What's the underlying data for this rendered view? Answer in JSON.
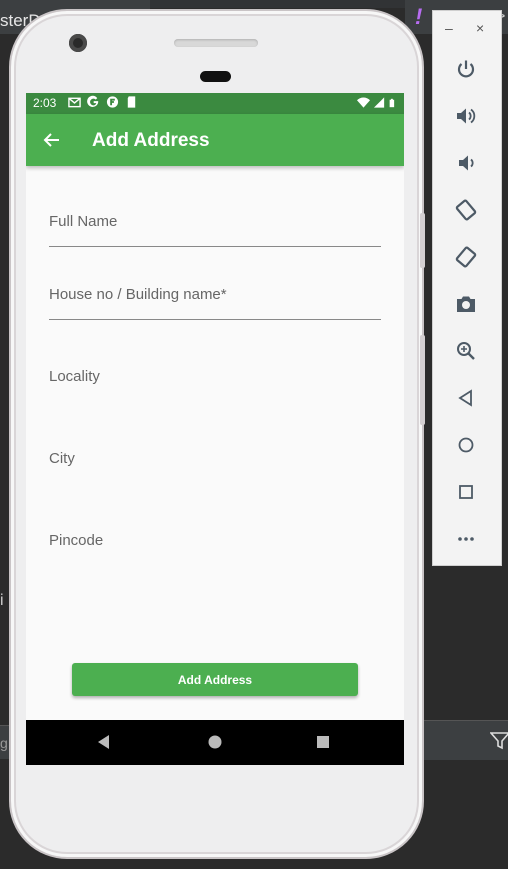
{
  "ide": {
    "tab_text": "sterD",
    "side_text": "i",
    "bottom_text": "g",
    "marker_color": "#b86cf2"
  },
  "status_bar": {
    "time": "2:03",
    "left_icons": [
      "gmail-icon",
      "google-icon",
      "flipboard-icon",
      "sd-card-icon"
    ],
    "right_icons": [
      "wifi-icon",
      "signal-icon",
      "battery-icon"
    ]
  },
  "app_bar": {
    "title": "Add Address",
    "back_icon": "arrow-left-icon",
    "color": "#4caf50"
  },
  "form": {
    "fields": [
      {
        "label": "Full Name",
        "value": ""
      },
      {
        "label": "House no / Building name*",
        "value": ""
      },
      {
        "label": "Locality",
        "value": ""
      },
      {
        "label": "City",
        "value": ""
      },
      {
        "label": "Pincode",
        "value": ""
      }
    ],
    "submit_label": "Add Address"
  },
  "nav_bar": {
    "buttons": [
      "back-triangle-icon",
      "home-circle-icon",
      "recents-square-icon"
    ]
  },
  "emulator_panel": {
    "minimize": "–",
    "close": "×",
    "buttons": [
      "power-icon",
      "volume-up-icon",
      "volume-down-icon",
      "rotate-left-icon",
      "rotate-right-icon",
      "camera-icon",
      "zoom-icon",
      "back-icon",
      "home-icon",
      "overview-icon",
      "more-icon"
    ]
  }
}
